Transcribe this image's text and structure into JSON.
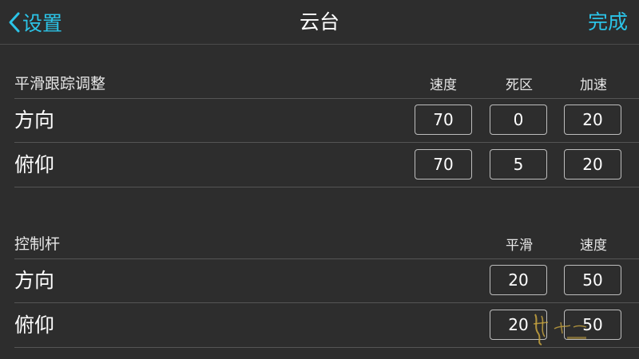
{
  "nav": {
    "back_label": "设置",
    "title": "云台",
    "done_label": "完成"
  },
  "smooth_track": {
    "title": "平滑跟踪调整",
    "columns": [
      "速度",
      "死区",
      "加速"
    ],
    "rows": [
      {
        "label": "方向",
        "values": [
          "70",
          "0",
          "20"
        ]
      },
      {
        "label": "俯仰",
        "values": [
          "70",
          "5",
          "20"
        ]
      }
    ]
  },
  "joystick": {
    "title": "控制杆",
    "columns": [
      "平滑",
      "速度"
    ],
    "rows": [
      {
        "label": "方向",
        "values": [
          "20",
          "50"
        ]
      },
      {
        "label": "俯仰",
        "values": [
          "20",
          "50"
        ]
      }
    ]
  },
  "colors": {
    "accent": "#2bc4e8",
    "background": "#2d2d2d",
    "text": "#ffffff",
    "divider": "#555555"
  },
  "icons": {
    "back": "chevron-left-icon"
  }
}
